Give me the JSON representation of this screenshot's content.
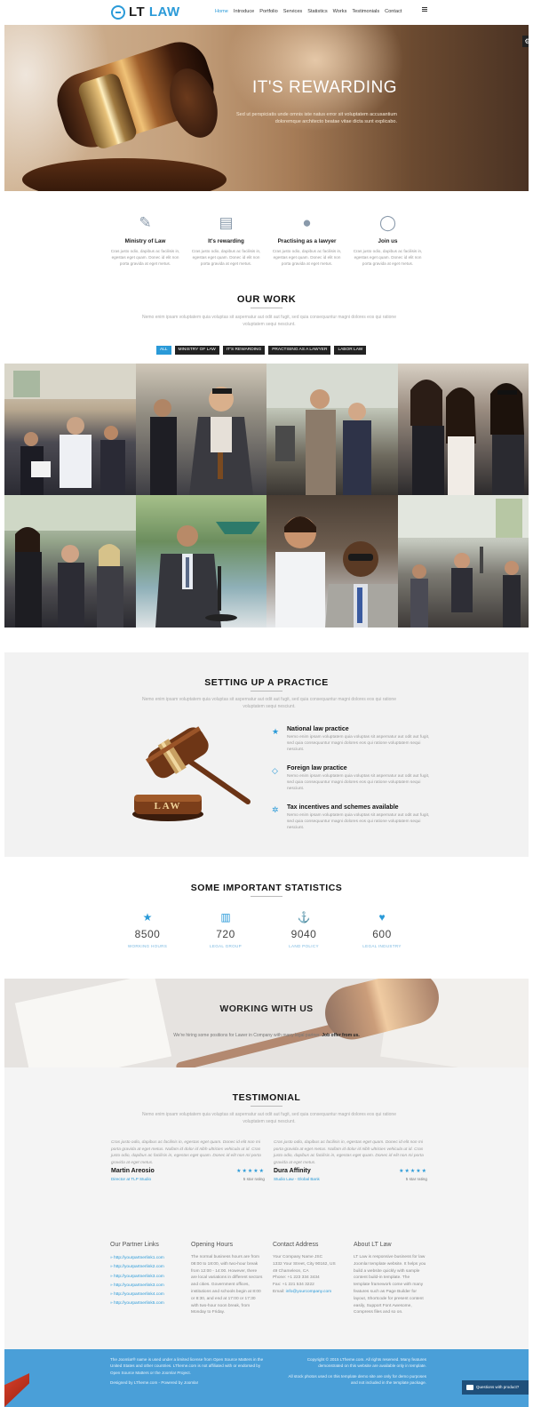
{
  "header": {
    "logo_lt": "LT",
    "logo_law": "LAW",
    "nav": [
      "Home",
      "Introduce",
      "Portfolio",
      "Services",
      "Statistics",
      "Works",
      "Testimonials",
      "Contact"
    ]
  },
  "hero": {
    "title": "IT'S REWARDING",
    "description": "Sed ut perspiciatis unde omnis iste natus error sit voluptatem accusantium doloremque architecto beatae vitae dicta sunt explicabo."
  },
  "features": [
    {
      "icon": "magic-wand-icon",
      "glyph": "⚖",
      "title": "Ministry of Law",
      "text": "Cras justo odio, dapibus ac facilisis in, egestas eget quam. Donec id elit non porta gravida at eget metus."
    },
    {
      "icon": "book-icon",
      "glyph": "▤",
      "title": "It's rewarding",
      "text": "Cras justo odio, dapibus ac facilisis in, egestas eget quam. Donec id elit non porta gravida at eget metus."
    },
    {
      "icon": "globe-icon",
      "glyph": "●",
      "title": "Practising as a lawyer",
      "text": "Cras justo odio, dapibus ac facilisis in, egestas eget quam. Donec id elit non porta gravida at eget metus."
    },
    {
      "icon": "chat-icon",
      "glyph": "◯",
      "title": "Join us",
      "text": "Cras justo odio, dapibus ac facilisis in, egestas eget quam. Donec id elit non porta gravida at eget metus."
    }
  ],
  "our_work": {
    "title": "OUR WORK",
    "description": "Nemo enim ipsam voluptatem quia voluptas sit aspernatur aut odit aut fugit, sed quia consequuntur magni dolores eos qui ratione voluptatem sequi nesciunt.",
    "filters": [
      "ALL",
      "MINISTRY OF LAW",
      "IT'S REWARDING",
      "PRACTISING AS A LAWYER",
      "LABOR LAW"
    ]
  },
  "practice": {
    "title": "SETTING UP A PRACTICE",
    "description": "Nemo enim ipsam voluptatem quia voluptas sit aspernatur aut odit aut fugit, sed quia consequuntur magni dolores eos qui ratione voluptatem sequi nesciunt.",
    "gavel_label": "LAW",
    "items": [
      {
        "icon": "star-icon",
        "title": "National law practice",
        "text": "Nemo enim ipsam voluptatem quia voluptas sit aspernatur aut odit aut fugit, sed quia consequuntur magni dolores eos qui ratione voluptatem sequi nesciunt."
      },
      {
        "icon": "diamond-icon",
        "title": "Foreign law practice",
        "text": "Nemo enim ipsam voluptatem quia voluptas sit aspernatur aut odit aut fugit, sed quia consequuntur magni dolores eos qui ratione voluptatem sequi nesciunt."
      },
      {
        "icon": "life-ring-icon",
        "title": "Tax incentives and schemes available",
        "text": "Nemo enim ipsam voluptatem quia voluptas sit aspernatur aut odit aut fugit, sed quia consequuntur magni dolores eos qui ratione voluptatem sequi nesciunt."
      }
    ]
  },
  "statistics": {
    "title": "SOME IMPORTANT STATISTICS",
    "items": [
      {
        "icon": "star-icon",
        "value": "8500",
        "label": "WORKING HOURS"
      },
      {
        "icon": "bank-icon",
        "value": "720",
        "label": "LEGAL GROUP"
      },
      {
        "icon": "anchor-icon",
        "value": "9040",
        "label": "LAND POLICY"
      },
      {
        "icon": "heart-icon",
        "value": "600",
        "label": "LEGAL INDUSTRY"
      }
    ]
  },
  "working": {
    "title": "WORKING WITH US",
    "text": "We're hiring some positions for Lawer in Company with many legal partner.",
    "link": "Job offer from us."
  },
  "testimonial": {
    "title": "TESTIMONIAL",
    "description": "Nemo enim ipsam voluptatem quia voluptas sit aspernatur aut odit aut fugit, sed quia consequuntur magni dolores eos qui ratione voluptatem sequi nesciunt.",
    "items": [
      {
        "quote": "Cras justo odio, dapibus ac facilisis in, egestas eget quam. Donec id elit non mi porta gravida at eget metus. Nullam id dolor id nibh ultricies vehicula ut id. Cras justo odio, dapibus ac facilisis in, egestas eget quam. Donec id elit non mi porta gravida at eget metus.",
        "name": "Martin Areosio",
        "role": "Director at TLP Studio",
        "stars": "★★★★★",
        "rating": "5 star rating"
      },
      {
        "quote": "Cras justo odio, dapibus ac facilisis in, egestas eget quam. Donec id elit non mi porta gravida at eget metus. Nullam id dolor id nibh ultricies vehicula ut id. Cras justo odio, dapibus ac facilisis in, egestas eget quam. Donec id elit non mi porta gravida at eget metus.",
        "name": "Dura Affinity",
        "role": "Studio Law - Global Bank",
        "stars": "★★★★★",
        "rating": "5 star rating"
      }
    ]
  },
  "footer": {
    "partners_title": "Our Partner Links",
    "partners": [
      "» http://yourpartnerlink1.com",
      "» http://yourpartnerlink2.com",
      "» http://yourpartnerlink3.com",
      "» http://yourpartnerlink3.com",
      "» http://yourpartnerlink4.com",
      "» http://yourpartnerlink5.com"
    ],
    "hours_title": "Opening Hours",
    "hours_text": "The normal business hours are from 08:00 to 18:00, with two-hour break from 12:00 - 14:00. However, there are local variations in different sectors and cities. Government offices, institutions and schools begin at 8:00 or 8:30, and end at 17:00 or 17:30 with two-hour noon break, from Monday to Friday.",
    "contact_title": "Contact Address",
    "contact_lines": [
      "Your Company Name JSC",
      "1332 Your Street, City 90162, US",
      "49 Chameleon, CA",
      "Phone: +1 223 334 3434",
      "Fax: +1 221 534 3222"
    ],
    "contact_email_label": "Email:",
    "contact_email": "info@yourcompany.com",
    "about_title": "About LT Law",
    "about_text": "LT Law is responsive business for law Joomla! template website. It helps you build a website quickly with sample content build-in template. The template framework come with many features such as Page Builder for layout, Shortcode for present content easily, Support Font Awesome, Compress files and so on."
  },
  "bottom_bar": {
    "left_text": "The Joomla!® name is used under a limited license from Open Source Matters in the United States and other countries. LTheme.com is not affiliated with or endorsed by Open Source Matters or the Joomla! Project.",
    "designed": "Designed by LTheme.com - Powered by Joomla!",
    "right_text1": "Copyright © 2015 LTheme.com. All rights reserved. Many features demonstrated on this website are available only in template.",
    "right_text2": "All stock photos used on this template demo site are only for demo purposes and not included in the template package.",
    "chat_label": "Questions with product?"
  },
  "colors": {
    "accent": "#2a9ad8",
    "dark": "#222222",
    "bottom_bar": "#4a9fd8"
  }
}
